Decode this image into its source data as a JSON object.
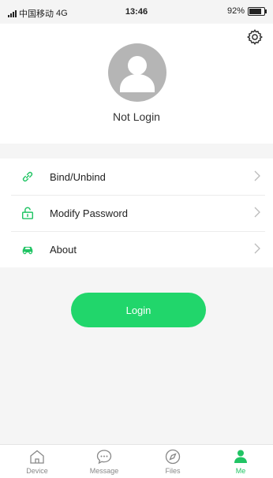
{
  "status_bar": {
    "carrier": "中国移动",
    "network": "4G",
    "time": "13:46",
    "battery_text": "92%",
    "battery_level": 0.92
  },
  "profile": {
    "name": "Not Login",
    "settings_icon": "gear-icon",
    "avatar_icon": "user-avatar-icon"
  },
  "menu": {
    "items": [
      {
        "label": "Bind/Unbind",
        "icon": "link-icon"
      },
      {
        "label": "Modify Password",
        "icon": "unlock-icon"
      },
      {
        "label": "About",
        "icon": "car-icon"
      }
    ]
  },
  "login_button": {
    "label": "Login"
  },
  "tab_bar": {
    "tabs": [
      {
        "label": "Device",
        "icon": "home-icon",
        "active": false
      },
      {
        "label": "Message",
        "icon": "chat-bubble-icon",
        "active": false
      },
      {
        "label": "Files",
        "icon": "compass-icon",
        "active": false
      },
      {
        "label": "Me",
        "icon": "person-icon",
        "active": true
      }
    ]
  },
  "colors": {
    "accent": "#21d66b",
    "active_tab": "#21c464",
    "background": "#f5f5f5"
  }
}
